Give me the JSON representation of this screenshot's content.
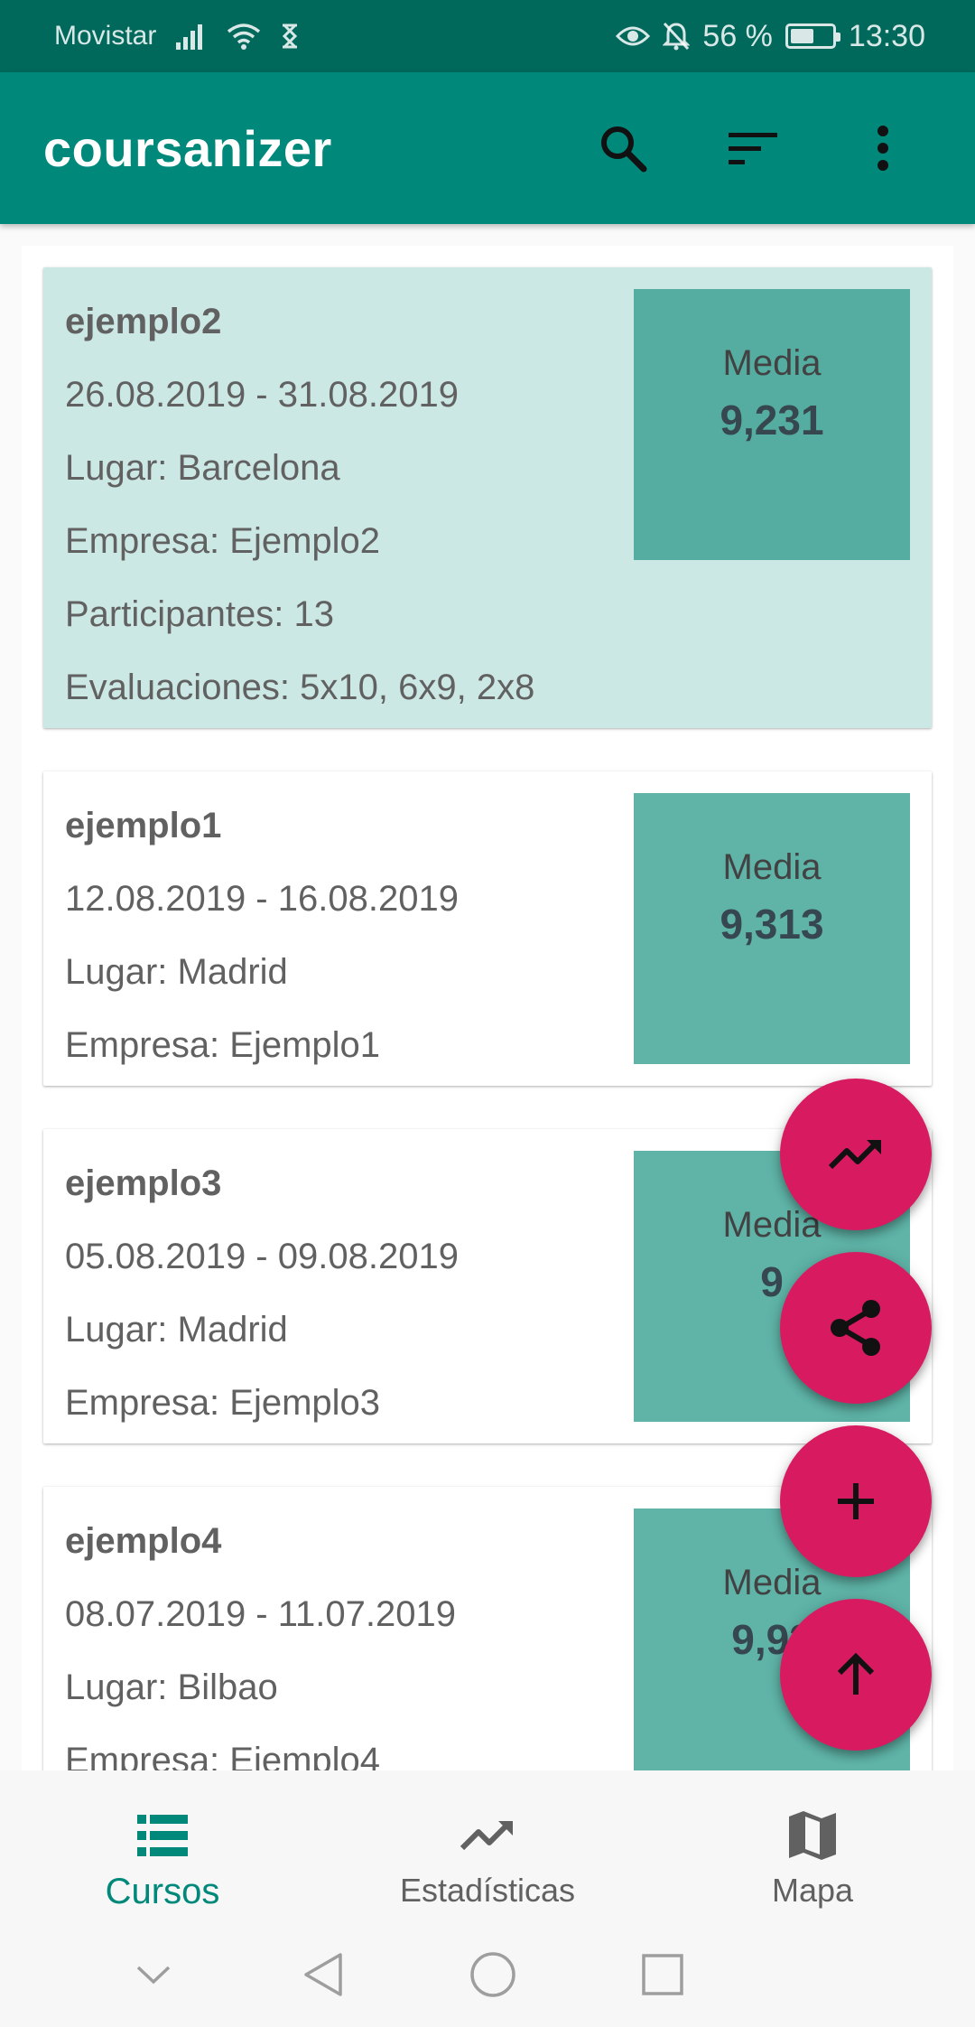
{
  "status_bar": {
    "carrier": "Movistar",
    "battery_percent": "56 %",
    "battery_level": 0.56,
    "time": "13:30"
  },
  "app_bar": {
    "title": "coursanizer",
    "actions": [
      "search-icon",
      "sort-icon",
      "more-vert-icon"
    ]
  },
  "courses": [
    {
      "name": "ejemplo2",
      "dates": "26.08.2019 - 31.08.2019",
      "place": "Lugar: Barcelona",
      "company": "Empresa: Ejemplo2",
      "participants": "Participantes: 13",
      "evaluations": "Evaluaciones: 5x10, 6x9, 2x8",
      "media_label": "Media",
      "media_value": "9,231",
      "selected": true
    },
    {
      "name": "ejemplo1",
      "dates": "12.08.2019 - 16.08.2019",
      "place": "Lugar: Madrid",
      "company": "Empresa: Ejemplo1",
      "media_label": "Media",
      "media_value": "9,313"
    },
    {
      "name": "ejemplo3",
      "dates": "05.08.2019 - 09.08.2019",
      "place": "Lugar: Madrid",
      "company": "Empresa: Ejemplo3",
      "media_label": "Media",
      "media_value": "9"
    },
    {
      "name": "ejemplo4",
      "dates": "08.07.2019 - 11.07.2019",
      "place": "Lugar: Bilbao",
      "company": "Empresa: Ejemplo4",
      "media_label": "Media",
      "media_value": "9,92"
    }
  ],
  "fabs": [
    "trending-up-icon",
    "share-icon",
    "add-icon",
    "arrow-up-icon"
  ],
  "bottom_nav": {
    "items": [
      {
        "label": "Cursos",
        "icon": "list-icon",
        "active": true
      },
      {
        "label": "Estadísticas",
        "icon": "trending-up-icon"
      },
      {
        "label": "Mapa",
        "icon": "map-icon"
      }
    ]
  },
  "colors": {
    "primary": "#00897b",
    "primary_dark": "#00695c",
    "accent": "#d81b60",
    "selected_card": "#cce8e4",
    "media_box": "#5fb3a7"
  }
}
